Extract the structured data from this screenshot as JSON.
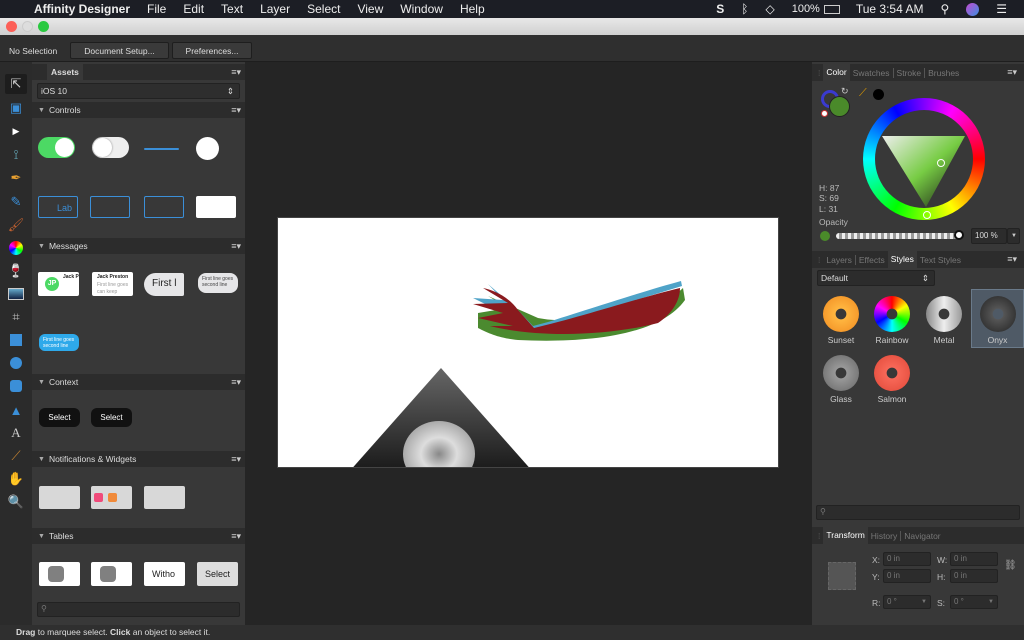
{
  "menubar": {
    "app": "Affinity Designer",
    "items": [
      "File",
      "Edit",
      "Text",
      "Layer",
      "Select",
      "View",
      "Window",
      "Help"
    ],
    "battery": "100%",
    "clock": "Tue 3:54 AM"
  },
  "context": {
    "selection": "No Selection",
    "document_setup": "Document Setup...",
    "preferences": "Preferences..."
  },
  "tools": [
    "move",
    "artboard",
    "node",
    "corner",
    "pen",
    "pencil",
    "brush",
    "color-picker-wheel",
    "fill",
    "place-image",
    "crop",
    "rectangle",
    "ellipse",
    "rounded-rectangle",
    "triangle",
    "text",
    "eyedropper",
    "hand",
    "zoom"
  ],
  "assets": {
    "tab": "Assets",
    "category": "iOS 10",
    "sections": [
      "Controls",
      "Messages",
      "Context",
      "Notifications & Widgets",
      "Tables"
    ],
    "messages": {
      "name": "Jack P",
      "name2": "Jack Preston",
      "line": "First line goes",
      "line2": "second line",
      "big": "First l",
      "keep": "can keep",
      "avatar": "JP"
    },
    "context_items": [
      "Select",
      "Select"
    ],
    "tables": [
      "Witho",
      "Select"
    ],
    "label_thumb": "Lab"
  },
  "color": {
    "tabs": [
      "Color",
      "Swatches",
      "Stroke",
      "Brushes"
    ],
    "h": "H: 87",
    "s": "S: 69",
    "l": "L: 31",
    "opacity_label": "Opacity",
    "opacity": "100 %",
    "fill": "#4a8a2a"
  },
  "styles": {
    "tabs": [
      "Layers",
      "Effects",
      "Styles",
      "Text Styles"
    ],
    "category": "Default",
    "items": [
      "Sunset",
      "Rainbow",
      "Metal",
      "Onyx",
      "Glass",
      "Salmon"
    ],
    "selected": "Onyx"
  },
  "transform": {
    "tabs": [
      "Transform",
      "History",
      "Navigator"
    ],
    "x_label": "X:",
    "y_label": "Y:",
    "w_label": "W:",
    "h_label": "H:",
    "r_label": "R:",
    "s_label": "S:",
    "x": "0 in",
    "y": "0 in",
    "w": "0 in",
    "h": "0 in",
    "r": "0 °",
    "s": "0 °"
  },
  "status": {
    "b1": "Drag",
    "t1": " to marquee select. ",
    "b2": "Click",
    "t2": " an object to select it."
  }
}
